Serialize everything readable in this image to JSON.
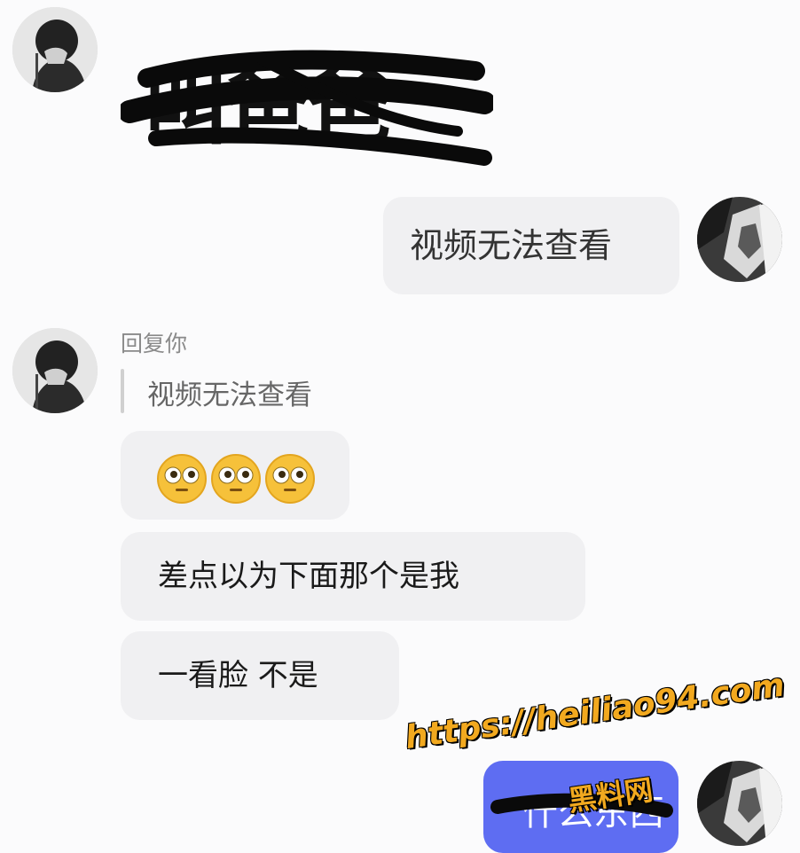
{
  "conversation": {
    "first_message_redacted": "叫爸爸",
    "outgoing_message": "视频无法查看",
    "reply": {
      "label": "回复你",
      "quoted_text": "视频无法查看"
    },
    "emoji_message": {
      "emoji_name": "flushed-face",
      "count": 3
    },
    "incoming_message_2": "差点以为下面那个是我",
    "incoming_message_3": "一看脸 不是",
    "outgoing_message_2_redacted": "什么东西"
  },
  "watermark": {
    "url": "https://heiliao94.com",
    "site_name": "黑料网",
    "color": "#f2a91f"
  },
  "colors": {
    "background": "#fbfbfc",
    "incoming_bubble": "#f0f0f2",
    "outgoing_bubble_blue": "#5e6df2"
  },
  "icons": {
    "left_avatar": "contact-avatar",
    "right_avatar": "own-avatar"
  }
}
